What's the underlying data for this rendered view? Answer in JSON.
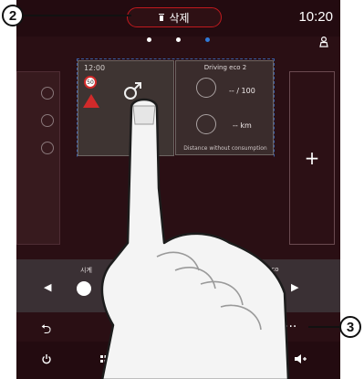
{
  "header": {
    "delete_label": "삭제",
    "time": "10:20"
  },
  "pager": {
    "pages": 3,
    "active_index": 2
  },
  "widget_a": {
    "time": "12:00",
    "speed_limit": "50"
  },
  "widget_b": {
    "title": "Driving eco 2",
    "value1": "-- / 100",
    "value2": "-- km",
    "caption": "Distance without consumption"
  },
  "add_panel": {
    "symbol": "+"
  },
  "dock": {
    "left_label": "시계",
    "right_label": "ing eco"
  },
  "toolbar": {
    "back_symbol": "⮌",
    "more_symbol": "···"
  },
  "callouts": {
    "c2": "2",
    "c3": "3"
  },
  "colors": {
    "screen_bg": "#2a0f14",
    "delete_border": "#c01a1e",
    "active_dot": "#2f7ad8",
    "grid_dash": "#3a5fa6"
  }
}
